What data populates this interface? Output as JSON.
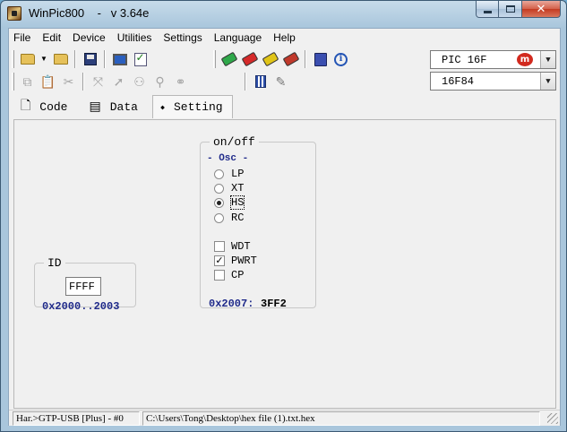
{
  "window": {
    "title": "WinPic800    -   v 3.64e",
    "controls": {
      "minimize": "minimize-icon",
      "maximize": "maximize-icon",
      "close": "close-icon"
    }
  },
  "menu": {
    "items": [
      {
        "label": "File",
        "icon": ""
      },
      {
        "label": "Edit"
      },
      {
        "label": "Device"
      },
      {
        "label": "Utilities"
      },
      {
        "label": "Settings"
      },
      {
        "label": "Language"
      },
      {
        "label": "Help"
      }
    ]
  },
  "toolbar": {
    "family_combo": {
      "value": "PIC 16F"
    },
    "device_combo": {
      "value": "16F84"
    },
    "logo_text": "m"
  },
  "tabs": [
    {
      "label": "Code",
      "icon": "code-icon"
    },
    {
      "label": "Data",
      "icon": "data-icon"
    },
    {
      "label": "Setting",
      "icon": "setting-icon",
      "active": true
    }
  ],
  "settings": {
    "id_group": {
      "title": "ID",
      "value": "FFFF",
      "address": "0x2000..2003"
    },
    "config_group": {
      "title": "on/off",
      "osc_title": "- Osc -",
      "osc_options": [
        {
          "label": "LP",
          "selected": false
        },
        {
          "label": "XT",
          "selected": false
        },
        {
          "label": "HS",
          "selected": true
        },
        {
          "label": "RC",
          "selected": false
        }
      ],
      "fuses": [
        {
          "label": "WDT",
          "checked": false
        },
        {
          "label": "PWRT",
          "checked": true
        },
        {
          "label": "CP",
          "checked": false
        }
      ],
      "config_address": "0x2007:",
      "config_value": "3FF2"
    }
  },
  "status": {
    "hardware": "Har.>GTP-USB [Plus] - #0",
    "file_path": "C:\\Users\\Tong\\Desktop\\hex file (1).txt.hex"
  }
}
